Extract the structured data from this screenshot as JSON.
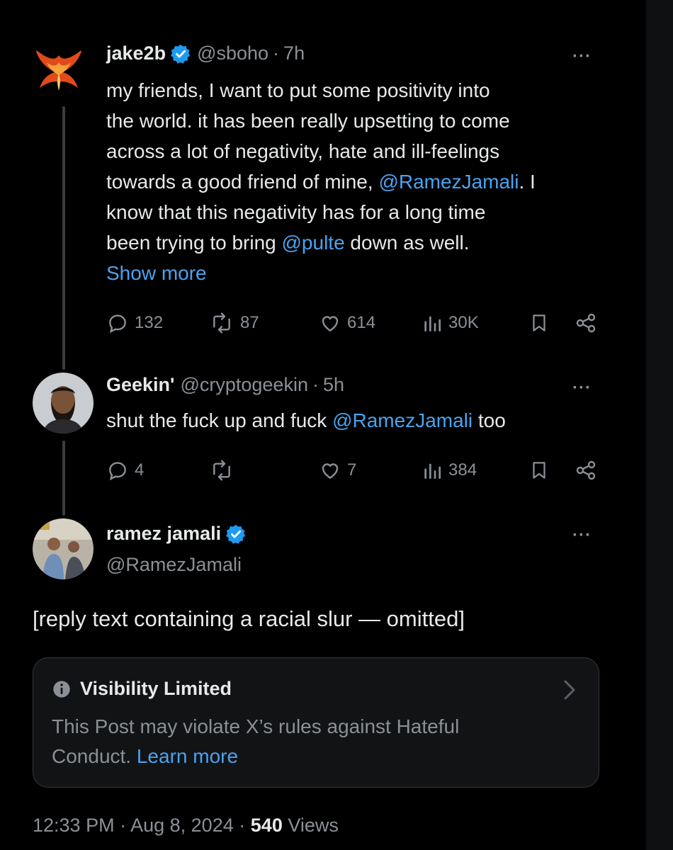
{
  "colors": {
    "background": "#000000",
    "text_primary": "#e7e9ea",
    "text_secondary": "#8b9096",
    "link": "#4aa3ef",
    "verified": "#1d9bf0",
    "thread_line": "#3a3d42",
    "notice_border": "#34373c"
  },
  "posts": [
    {
      "name": "jake2b",
      "verified": true,
      "handle": "@sboho",
      "separator": "·",
      "time": "7h",
      "text_lines": [
        [
          {
            "t": "my friends, I want to put some positivity into"
          }
        ],
        [
          {
            "t": "the world. it has been really upsetting to come"
          }
        ],
        [
          {
            "t": "across a lot of negativity, hate and ill-feelings"
          }
        ],
        [
          {
            "t": "towards a good friend of mine, "
          },
          {
            "t": "@RamezJamali",
            "m": true
          },
          {
            "t": ". I"
          }
        ],
        [
          {
            "t": "know that this negativity has for a long time"
          }
        ],
        [
          {
            "t": "been trying to bring "
          },
          {
            "t": "@pulte",
            "m": true
          },
          {
            "t": " down as well."
          }
        ]
      ],
      "show_more": "Show more",
      "stats": {
        "replies": "132",
        "reposts": "87",
        "likes": "614",
        "views": "30K"
      },
      "icons": [
        "reply-icon",
        "repost-icon",
        "like-icon",
        "views-icon",
        "bookmark-icon",
        "share-icon"
      ]
    },
    {
      "name": "Geekin'",
      "verified": false,
      "handle": "@cryptogeekin",
      "separator": "·",
      "time": "5h",
      "text_lines": [
        [
          {
            "t": "shut the fuck up and fuck "
          },
          {
            "t": "@RamezJamali",
            "m": true
          },
          {
            "t": " too"
          }
        ]
      ],
      "stats": {
        "replies": "4",
        "reposts": "",
        "likes": "7",
        "views": "384"
      }
    }
  ],
  "main_post": {
    "name": "ramez jamali",
    "verified": true,
    "handle": "@RamezJamali",
    "text": "[reply text containing a racial slur — omitted]",
    "notice": {
      "title": "Visibility Limited",
      "body_line1": "This Post may violate X’s rules against Hateful",
      "body_line2": "Conduct.",
      "learn_more": "Learn more"
    },
    "footer": {
      "time": "12:33 PM",
      "sep1": "·",
      "date": "Aug 8, 2024",
      "sep2": "·",
      "views_count": "540",
      "views_label": "Views"
    }
  },
  "more_label": "···"
}
